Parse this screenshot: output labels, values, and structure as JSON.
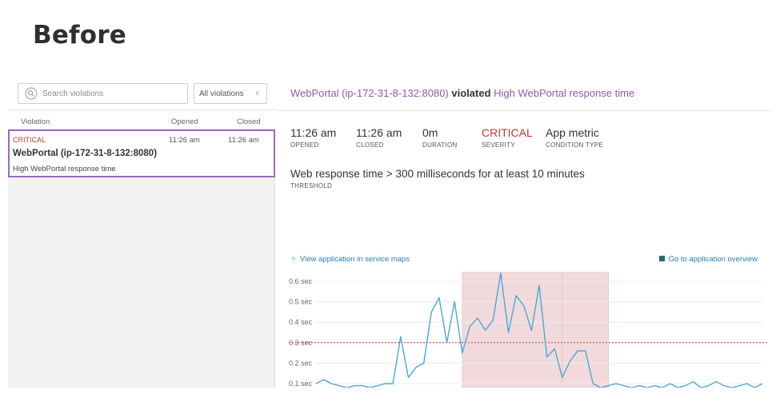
{
  "heading": "Before",
  "search": {
    "placeholder": "Search violations",
    "filter_value": "All violations"
  },
  "list": {
    "columns": {
      "violation": "Violation",
      "opened": "Opened",
      "closed": "Closed"
    },
    "rows": [
      {
        "severity": "CRITICAL",
        "opened": "11:26 am",
        "closed": "11:26 am",
        "entity": "WebPortal (ip-172-31-8-132:8080)",
        "condition": "High WebPortal response time"
      }
    ]
  },
  "detail": {
    "entity": "WebPortal (ip-172-31-8-132:8080)",
    "verb": "violated",
    "condition": "High WebPortal response time",
    "stats": [
      {
        "value": "11:26 am",
        "label": "OPENED"
      },
      {
        "value": "11:26 am",
        "label": "CLOSED"
      },
      {
        "value": "0m",
        "label": "DURATION"
      },
      {
        "value": "CRITICAL",
        "label": "SEVERITY"
      },
      {
        "value": "App metric",
        "label": "CONDITION TYPE"
      }
    ],
    "threshold": {
      "value": "Web response time > 300 milliseconds for at least 10 minutes",
      "label": "THRESHOLD"
    },
    "service_maps_link": "View application in service maps",
    "overview_link": "Go to application overview"
  },
  "colors": {
    "accent": "#8e5ab0",
    "critical": "#c0392b",
    "line": "#4aa8d8",
    "threshold": "#c0392b",
    "violation_band": "#f2d9dc"
  },
  "chart_data": {
    "type": "line",
    "y_ticks": [
      "0.6 sec",
      "0.5 sec",
      "0.4 sec",
      "0.3 sec",
      "0.2 sec",
      "0.1 sec"
    ],
    "ylim": [
      0.1,
      0.6
    ],
    "threshold": 0.3,
    "x_index_range": [
      0,
      58
    ],
    "violation_bands": [
      [
        19,
        32
      ],
      [
        32,
        38
      ]
    ],
    "series": [
      {
        "values": [
          0.1,
          0.12,
          0.1,
          0.09,
          0.08,
          0.09,
          0.09,
          0.08,
          0.09,
          0.1,
          0.1,
          0.33,
          0.13,
          0.18,
          0.2,
          0.45,
          0.52,
          0.3,
          0.5,
          0.25,
          0.38,
          0.42,
          0.36,
          0.41,
          0.64,
          0.35,
          0.53,
          0.48,
          0.36,
          0.58,
          0.23,
          0.27,
          0.13,
          0.21,
          0.26,
          0.26,
          0.1,
          0.08,
          0.09,
          0.1,
          0.09,
          0.08,
          0.09,
          0.08,
          0.09,
          0.08,
          0.1,
          0.08,
          0.09,
          0.11,
          0.08,
          0.09,
          0.11,
          0.09,
          0.08,
          0.09,
          0.1,
          0.08,
          0.1
        ]
      }
    ]
  }
}
